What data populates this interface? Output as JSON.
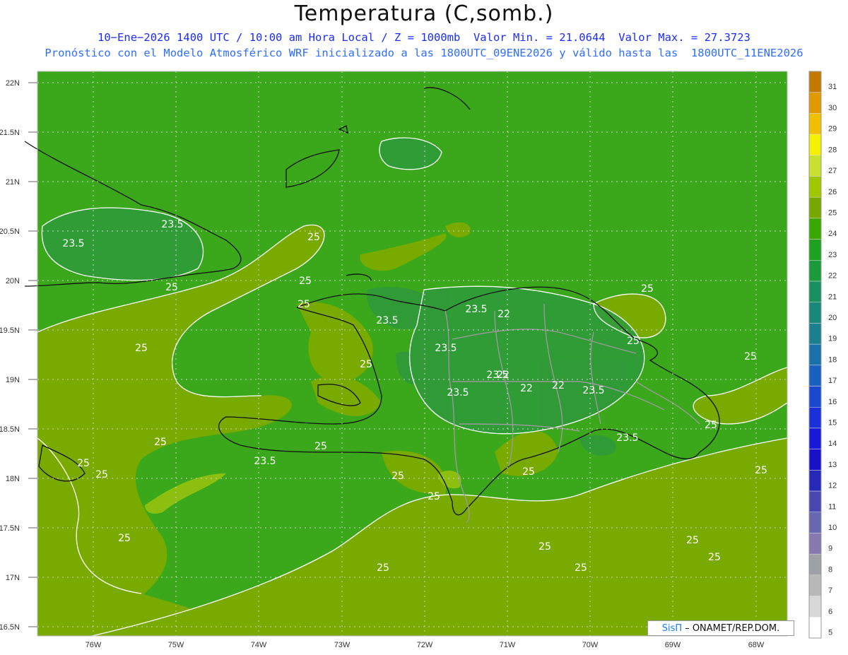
{
  "header": {
    "title": "Temperatura (C,somb.)",
    "line1": "10−Ene−2026 1400 UTC / 10:00 am Hora Local / Z = 1000mb  Valor Min. = 21.0644  Valor Max. = 27.3723",
    "line2": "Pronóstico con el Modelo Atmosférico WRF inicializado a las 1800UTC_09ENE2026 y válido hasta las  1800UTC_11ENE2026"
  },
  "axes": {
    "lat_labels": [
      "22N",
      "21.5N",
      "21N",
      "20.5N",
      "20N",
      "19.5N",
      "19N",
      "18.5N",
      "18N",
      "17.5N",
      "17N",
      "16.5N"
    ],
    "lon_labels": [
      "76W",
      "75W",
      "74W",
      "73W",
      "72W",
      "71W",
      "70W",
      "69W",
      "68W"
    ]
  },
  "colorbar": {
    "levels": [
      "31",
      "30",
      "29",
      "28",
      "27",
      "26",
      "25",
      "24",
      "23",
      "22",
      "21",
      "20",
      "19",
      "18",
      "17",
      "16",
      "15",
      "14",
      "13",
      "12",
      "11",
      "10",
      "9",
      "8",
      "7",
      "6",
      "5"
    ],
    "colors": [
      "#c47a00",
      "#e09a00",
      "#f0c000",
      "#f5f000",
      "#c8e030",
      "#a0c800",
      "#78a800",
      "#38a800",
      "#20a020",
      "#1a9a3a",
      "#1a9060",
      "#1a8878",
      "#1a8090",
      "#1a70a8",
      "#1a60c0",
      "#1a48d0",
      "#1a30d8",
      "#1a18d8",
      "#1a10c8",
      "#2828b8",
      "#4848b0",
      "#6868b0",
      "#8878b0",
      "#a0a0a8",
      "#b8b8b8",
      "#d8d8d8",
      "#ffffff"
    ]
  },
  "map": {
    "field_colors": {
      "level_24": "#3aa81a",
      "level_25": "#78aa00",
      "level_23": "#30a040",
      "level_26": "#8cbf10"
    },
    "contour_labels": [
      "23.5",
      "23.5",
      "25",
      "25",
      "25",
      "25",
      "23.5",
      "23.5",
      "23.5",
      "22",
      "25",
      "25",
      "25",
      "23.5",
      "22",
      "23.5",
      "23.5",
      "22",
      "22",
      "23.5",
      "25",
      "25",
      "25",
      "25",
      "23.5",
      "25",
      "25",
      "25",
      "25",
      "25",
      "25",
      "25",
      "25",
      "25",
      "25",
      "25",
      "25",
      "25"
    ]
  },
  "credit": {
    "brand": "SisΠ",
    "text": "– ONAMET/REP.DOM."
  }
}
